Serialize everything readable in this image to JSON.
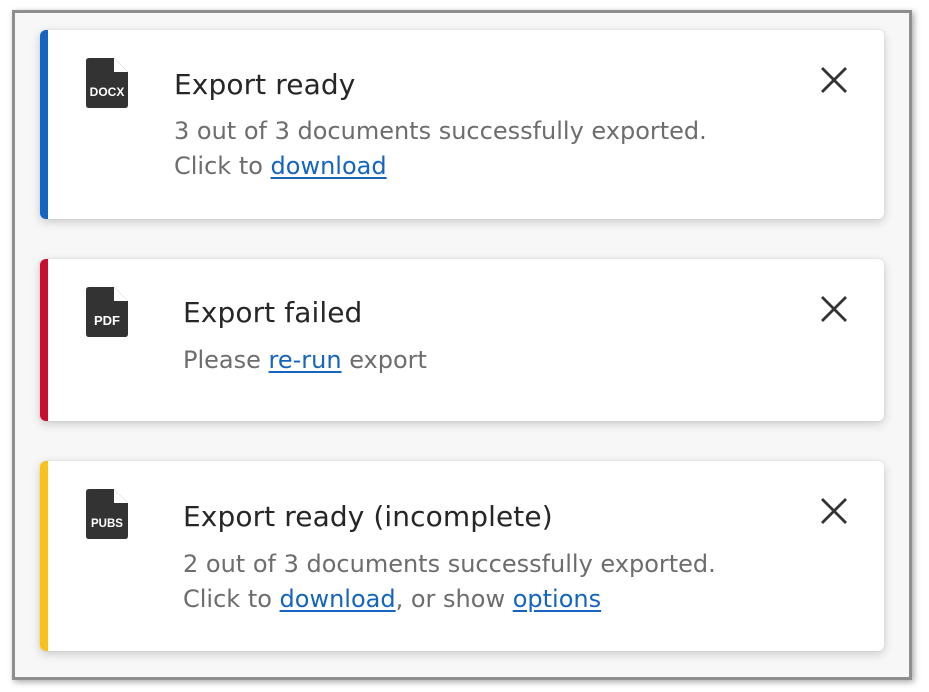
{
  "toasts": [
    {
      "accent_color": "#1565c0",
      "icon": "docx-file-icon",
      "icon_label": "DOCX",
      "title": "Export ready",
      "line1": "3 out of 3 documents successfully exported.",
      "line2_prefix": "Click to ",
      "download_link": "download"
    },
    {
      "accent_color": "#c8102e",
      "icon": "pdf-file-icon",
      "icon_label": "PDF",
      "title": "Export failed",
      "line1_prefix": "Please ",
      "rerun_link": "re-run",
      "line1_suffix": " export"
    },
    {
      "accent_color": "#f9c21b",
      "icon": "pubs-file-icon",
      "icon_label": "PUBS",
      "title": "Export ready (incomplete)",
      "line1": "2 out of 3 documents successfully exported.",
      "line2_prefix": "Click to ",
      "download_link": "download",
      "line2_middle": ", or show ",
      "options_link": "options"
    }
  ],
  "close_icon": "close-icon"
}
